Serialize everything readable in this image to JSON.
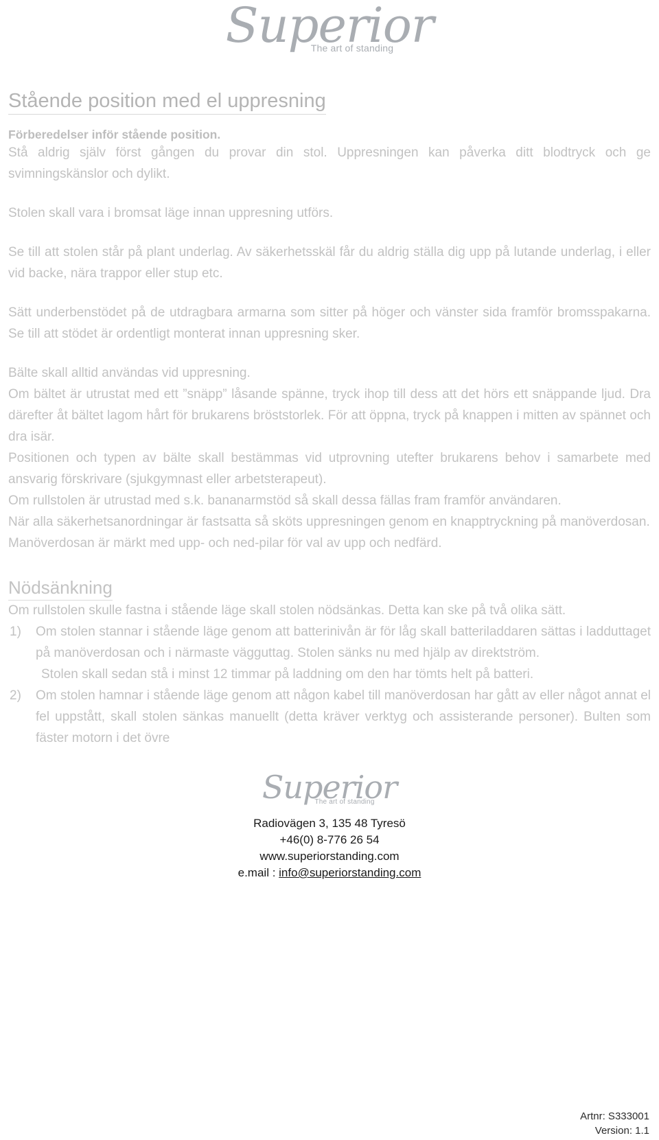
{
  "logo": {
    "wordmark": "Superior",
    "tagline": "The art of standing"
  },
  "document": {
    "title": "Stående position med el uppresning",
    "subheading": "Förberedelser inför stående position."
  },
  "paragraphs": {
    "p1": "Stå aldrig själv först gången du provar din stol. Uppresningen kan påverka ditt blodtryck och ge svimningskänslor och dylikt.",
    "p2": "Stolen skall vara i bromsat läge innan uppresning utförs.",
    "p3": "Se till att stolen står på plant underlag. Av säkerhetsskäl får du aldrig ställa dig upp på lutande underlag, i eller vid backe, nära trappor eller stup etc.",
    "p4": "Sätt underbenstödet på de utdragbara armarna som sitter på höger och vänster sida framför bromsspakarna. Se till att stödet är ordentligt monterat innan uppresning sker.",
    "p5": "Bälte skall alltid användas vid uppresning.",
    "p6": "Om bältet är utrustat med ett ”snäpp” låsande spänne, tryck ihop till dess att det hörs ett snäppande ljud. Dra därefter åt bältet lagom hårt för brukarens bröststorlek. För att öppna, tryck på knappen i mitten av spännet och dra isär.",
    "p7": "Positionen och typen av bälte skall bestämmas vid utprovning utefter brukarens behov i samarbete med ansvarig förskrivare (sjukgymnast eller arbetsterapeut).",
    "p8": "Om rullstolen är utrustad med s.k. bananarmstöd så skall dessa fällas fram framför användaren.",
    "p9": "När alla säkerhetsanordningar är fastsatta så sköts uppresningen genom en knapptryckning på manöverdosan.",
    "p10": "Manöverdosan är märkt med upp- och ned-pilar för val av upp och nedfärd."
  },
  "emergency": {
    "heading": "Nödsänkning",
    "intro": "Om rullstolen skulle fastna i stående läge skall stolen nödsänkas. Detta kan ske på två olika sätt.",
    "items": [
      {
        "marker": "1)",
        "text": "Om stolen stannar i stående läge genom att batterinivån är för låg skall batteriladdaren sättas i ladduttaget på manöverdosan och i närmaste vägguttag. Stolen sänks nu med hjälp av direktström.",
        "sub": "Stolen skall sedan stå i minst 12 timmar på laddning om den har tömts helt på batteri."
      },
      {
        "marker": "2)",
        "text": "Om stolen hamnar i stående läge genom att någon kabel till manöverdosan har gått av eller något annat el fel uppstått, skall stolen sänkas manuellt (detta kräver verktyg och assisterande personer). Bulten som fäster motorn i det övre",
        "sub": ""
      }
    ]
  },
  "footer": {
    "address": "Radiovägen 3, 135 48 Tyresö",
    "phone": "+46(0) 8-776 26 54",
    "website": "www.superiorstanding.com",
    "email_label": "e.mail : ",
    "email": "info@superiorstanding.com"
  },
  "meta": {
    "article_number": "Artnr: S333001",
    "version": "Version: 1.1"
  },
  "colors": {
    "body_text": "#c2c2c2",
    "heading": "#b4b4b4",
    "logo": "#a9adb2",
    "footer_text": "#1a1a1a"
  }
}
